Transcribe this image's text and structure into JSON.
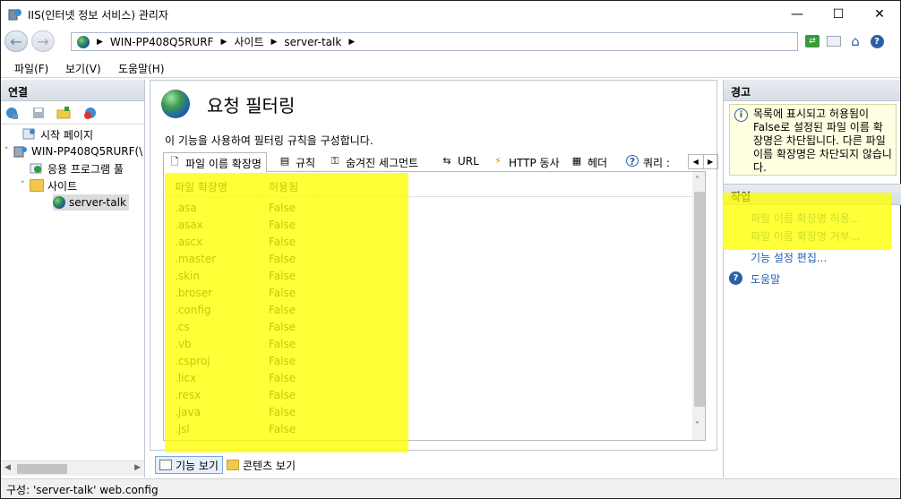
{
  "window": {
    "title": "IIS(인터넷 정보 서비스) 관리자",
    "minimize": "—",
    "maximize": "☐",
    "close": "✕"
  },
  "address": {
    "back": "←",
    "forward": "→",
    "crumbs": [
      "WIN-PP408Q5RURF",
      "사이트",
      "server-talk"
    ],
    "separator": "▶"
  },
  "menu": [
    "파일(F)",
    "보기(V)",
    "도움말(H)"
  ],
  "connections": {
    "header": "연결",
    "tree": [
      {
        "label": "시작 페이지",
        "icon": "start-page-icon"
      },
      {
        "label": "WIN-PP408Q5RURF(\\",
        "icon": "server-icon"
      },
      {
        "label": "응용 프로그램 풀",
        "icon": "app-pool-icon"
      },
      {
        "label": "사이트",
        "icon": "folder-icon"
      },
      {
        "label": "server-talk",
        "icon": "globe-icon"
      }
    ]
  },
  "feature": {
    "title": "요청 필터링",
    "description": "이 기능을 사용하여 필터링 규칙을 구성합니다.",
    "tabs": [
      {
        "label": "파일 이름 확장명",
        "icon": "file-icon",
        "glyph": "🗋"
      },
      {
        "label": "규칙",
        "icon": "rules-icon",
        "glyph": "▤"
      },
      {
        "label": "숨겨진 세그먼트",
        "icon": "segment-icon",
        "glyph": "⚿"
      },
      {
        "label": "URL",
        "icon": "url-icon",
        "glyph": "⇆"
      },
      {
        "label": "HTTP 동사",
        "icon": "verb-icon",
        "glyph": "⚡"
      },
      {
        "label": "헤더",
        "icon": "header-icon",
        "glyph": "▦"
      },
      {
        "label": "쿼리 :",
        "icon": "query-icon",
        "glyph": "?"
      }
    ],
    "columns": [
      "파일 확장명",
      "허용됨"
    ],
    "rows": [
      [
        ".asa",
        "False"
      ],
      [
        ".asax",
        "False"
      ],
      [
        ".ascx",
        "False"
      ],
      [
        ".master",
        "False"
      ],
      [
        ".skin",
        "False"
      ],
      [
        ".broser",
        "False"
      ],
      [
        ".config",
        "False"
      ],
      [
        ".cs",
        "False"
      ],
      [
        ".vb",
        "False"
      ],
      [
        ".csproj",
        "False"
      ],
      [
        ".licx",
        "False"
      ],
      [
        ".resx",
        "False"
      ],
      [
        ".java",
        "False"
      ],
      [
        ".jsl",
        "False"
      ]
    ],
    "view_features": "기능 보기",
    "view_content": "콘텐츠 보기"
  },
  "actions": {
    "alert_header": "경고",
    "alert_text": "목록에 표시되고 허용됨이 False로 설정된 파일 이름 확장명은 차단됩니다. 다른 파일 이름 확장명은 차단되지 않습니다.",
    "tasks_header": "작업",
    "links": [
      "파일 이름 확장명 허용...",
      "파일 이름 확장명 거부...",
      "기능 설정 편집..."
    ],
    "help": "도움말"
  },
  "status": "구성: 'server-talk' web.config",
  "colors": {
    "highlight": "#ffff00",
    "link": "#1d5fbf",
    "panel_header": "#d7dde5"
  }
}
